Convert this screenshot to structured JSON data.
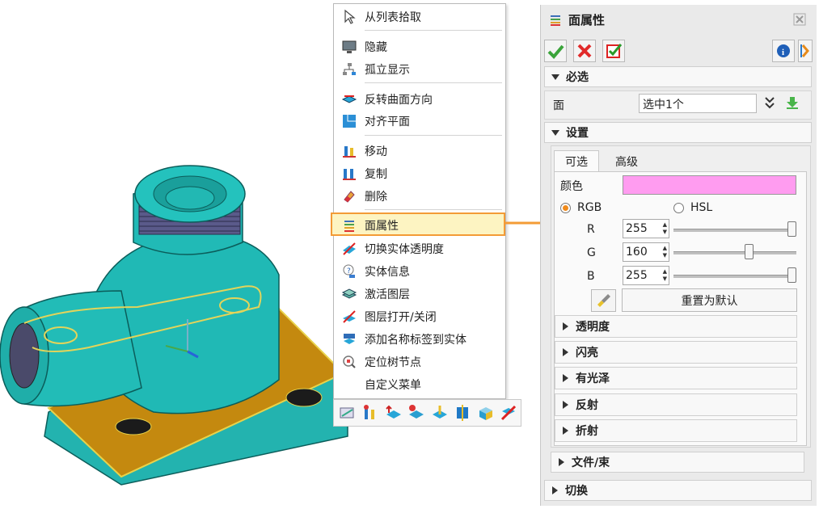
{
  "context_menu": {
    "items": [
      {
        "label": "从列表拾取",
        "icon": "cursor-icon"
      },
      {
        "label": "隐藏",
        "icon": "monitor-icon"
      },
      {
        "label": "孤立显示",
        "icon": "tree-icon"
      },
      {
        "label": "反转曲面方向",
        "icon": "flip-surface-icon"
      },
      {
        "label": "对齐平面",
        "icon": "align-plane-icon"
      },
      {
        "label": "移动",
        "icon": "move-icon"
      },
      {
        "label": "复制",
        "icon": "copy-icon"
      },
      {
        "label": "删除",
        "icon": "eraser-icon"
      },
      {
        "label": "面属性",
        "icon": "face-properties-icon"
      },
      {
        "label": "切换实体透明度",
        "icon": "transparency-icon"
      },
      {
        "label": "实体信息",
        "icon": "info-icon"
      },
      {
        "label": "激活图层",
        "icon": "layer-icon"
      },
      {
        "label": "图层打开/关闭",
        "icon": "layer-toggle-icon"
      },
      {
        "label": "添加名称标签到实体",
        "icon": "name-tag-icon"
      },
      {
        "label": "定位树节点",
        "icon": "locate-tree-icon"
      },
      {
        "label": "自定义菜单",
        "icon": ""
      }
    ]
  },
  "panel": {
    "title": "面属性",
    "required_section": "必选",
    "face_label": "面",
    "face_value": "选中1个",
    "settings_section": "设置",
    "tabs": [
      "可选",
      "高级"
    ],
    "color_label": "颜色",
    "color_value": "#ff9cf0",
    "rgb_label": "RGB",
    "hsl_label": "HSL",
    "r_label": "R",
    "r_value": "255",
    "r_level": 1.0,
    "g_label": "G",
    "g_value": "160",
    "g_level": 0.627,
    "b_label": "B",
    "b_value": "255",
    "b_level": 1.0,
    "reset_label": "重置为默认",
    "sub_sections": [
      "透明度",
      "闪亮",
      "有光泽",
      "反射",
      "折射"
    ],
    "file_section": "文件/束",
    "switch_section": "切换"
  },
  "colors": {
    "accent": "#f39b36",
    "model": "#1fb8b4",
    "highlight_face": "#c48a12"
  }
}
